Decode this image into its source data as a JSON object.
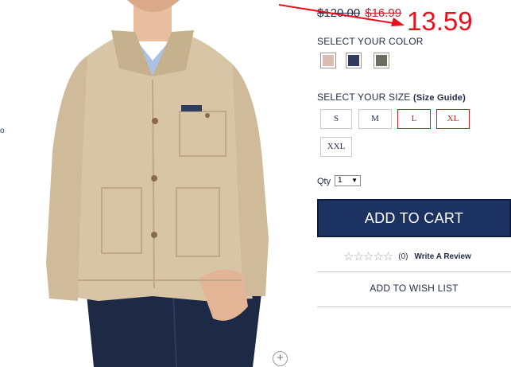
{
  "product_image": {
    "alt": "Tan canvas jacket",
    "zoom_symbol": "+"
  },
  "edge_fragment": "o",
  "price": {
    "original": "$120.00",
    "sale": "$16.99",
    "annotation": "13.59"
  },
  "color": {
    "label": "SELECT YOUR COLOR",
    "swatches": [
      {
        "name": "khaki",
        "hex": "#d9bdb1"
      },
      {
        "name": "navy",
        "hex": "#2f3a5e"
      },
      {
        "name": "olive",
        "hex": "#6b6d5e"
      }
    ]
  },
  "size": {
    "label": "SELECT YOUR SIZE",
    "guide_label": "(Size Guide)",
    "options": [
      {
        "label": "S",
        "available": true
      },
      {
        "label": "M",
        "available": true
      },
      {
        "label": "L",
        "available": false
      },
      {
        "label": "XL",
        "available": false
      },
      {
        "label": "XXL",
        "available": true
      }
    ]
  },
  "qty": {
    "label": "Qty",
    "value": "1"
  },
  "cart": {
    "button_label": "ADD TO CART"
  },
  "reviews": {
    "stars": "☆☆☆☆☆",
    "count": "(0)",
    "write_label": "Write A Review"
  },
  "wishlist": {
    "label": "ADD TO WISH LIST"
  },
  "colors": {
    "brand_navy": "#1c3361",
    "sale_red": "#c8202a",
    "annotation_red": "#e8101c",
    "khaki": "#d8c5a6"
  }
}
